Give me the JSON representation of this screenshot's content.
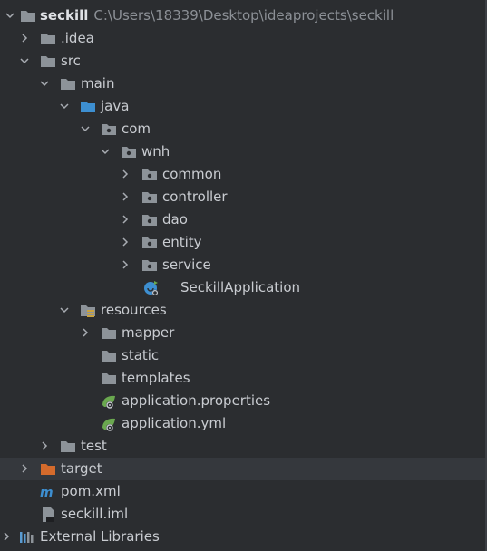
{
  "project_root": {
    "name": "seckill",
    "path": "C:\\Users\\18339\\Desktop\\ideaprojects\\seckill"
  },
  "items": {
    "idea": ".idea",
    "src": "src",
    "main": "main",
    "java": "java",
    "com": "com",
    "wnh": "wnh",
    "common": "common",
    "controller": "controller",
    "dao": "dao",
    "entity": "entity",
    "service": "service",
    "app_class": "SeckillApplication",
    "resources": "resources",
    "mapper": "mapper",
    "static": "static",
    "templates": "templates",
    "app_props": "application.properties",
    "app_yml": "application.yml",
    "test": "test",
    "target": "target",
    "pom": "pom.xml",
    "iml": "seckill.iml",
    "ext_libs": "External Libraries"
  },
  "icons": {
    "folder": "folder-icon",
    "package": "package-icon",
    "source_root": "source-root-icon",
    "resources_root": "resources-root-icon",
    "excluded": "excluded-folder-icon",
    "spring_config": "spring-config-icon",
    "spring_app": "spring-boot-app-icon",
    "maven": "maven-icon",
    "iml": "iml-file-icon",
    "libraries": "libraries-icon"
  },
  "colors": {
    "background": "#2b2d30",
    "folder": "#8d9399",
    "source_root": "#3d8fd1",
    "excluded": "#d56b2c",
    "spring": "#6aa84f",
    "text": "#c9ccd1"
  }
}
